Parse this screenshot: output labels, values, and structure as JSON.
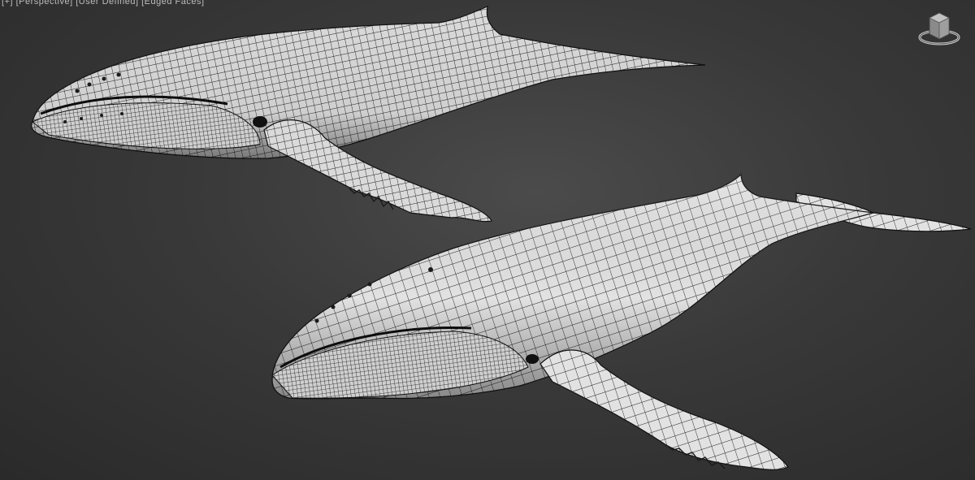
{
  "viewport": {
    "label": "[+] [Perspective] [User Defined] [Edged Faces]",
    "background": "#3c3c3c"
  },
  "models": [
    {
      "name": "humpback-whale-upper",
      "view": "side-below",
      "mesh_color": "#d9d9d9",
      "wire_color": "#1a1a1a"
    },
    {
      "name": "humpback-whale-lower",
      "view": "side-above",
      "mesh_color": "#e0e0e0",
      "wire_color": "#1a1a1a"
    }
  ],
  "viewcube": {
    "icon": "viewcube-icon",
    "face_color": "#9a9a9a",
    "ring_color": "#d0d0d0"
  }
}
